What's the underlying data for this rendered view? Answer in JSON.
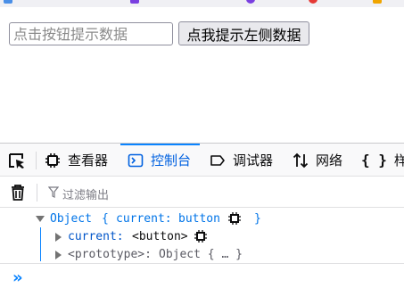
{
  "page": {
    "input_placeholder": "点击按钮提示数据",
    "button_label": "点我提示左侧数据"
  },
  "devtools": {
    "tabs": [
      {
        "label": "查看器",
        "icon": "inspector-icon"
      },
      {
        "label": "控制台",
        "icon": "console-icon",
        "active": true
      },
      {
        "label": "调试器",
        "icon": "debugger-icon"
      },
      {
        "label": "网络",
        "icon": "network-icon"
      },
      {
        "label": "样式",
        "icon": "style-editor-icon"
      }
    ],
    "filter_placeholder": "过滤输出",
    "console": {
      "object_label": "Object",
      "object_open": "{",
      "object_key": "current:",
      "object_value": "button",
      "object_close": "}",
      "current_key": "current:",
      "current_value": "<button>",
      "prototype_key": "<prototype>:",
      "prototype_value": "Object { … }"
    },
    "prompt_symbol": "»"
  },
  "colors": {
    "accent": "#0a84ff",
    "active_tab_text": "#0061e0"
  }
}
